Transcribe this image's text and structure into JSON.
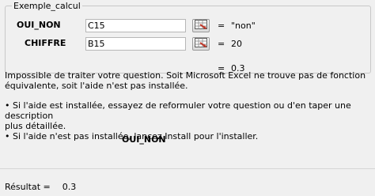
{
  "group": {
    "title": "Exemple_calcul"
  },
  "args": [
    {
      "label": "OUI_NON",
      "value": "C15",
      "result": "\"non\""
    },
    {
      "label": "CHIFFRE",
      "value": "B15",
      "result": "20"
    }
  ],
  "equals_sign": "=",
  "formula_result": "0.3",
  "message": {
    "line1": "Impossible de traiter votre question. Soit Microsoft Excel ne trouve pas de fonction",
    "line2": "équivalente, soit l'aide n'est pas installée.",
    "line3": "• Si l'aide est installée, essayez de reformuler votre question ou d'en taper une description",
    "line4": "plus détaillée.",
    "line5": "• Si l'aide n'est pas installée, lancez Install pour l'installer."
  },
  "function_arg_name": "OUI_NON",
  "footer": {
    "label": "Résultat =",
    "value": "0.3"
  },
  "icons": {
    "ref_button": "collapse-dialog-icon"
  }
}
